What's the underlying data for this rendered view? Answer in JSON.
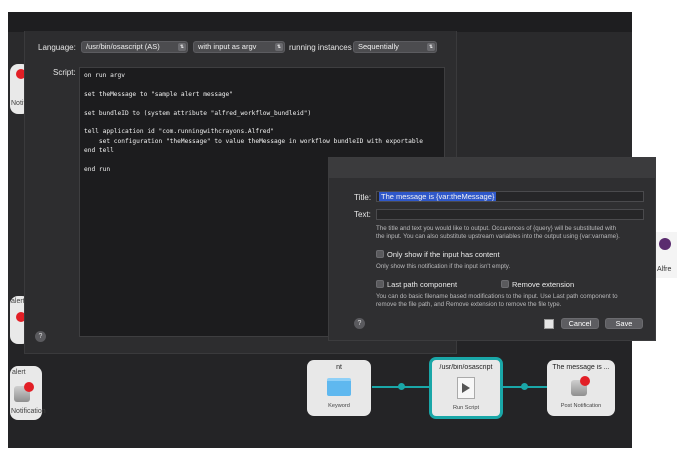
{
  "editor": {
    "language_label": "Language:",
    "language_value": "/usr/bin/osascript (AS)",
    "input_value": "with input as argv",
    "instances_label": "running instances",
    "instances_value": "Sequentially",
    "script_label": "Script:",
    "script_text": "on run argv\n\nset theMessage to \"sample alert message\"\n\nset bundleID to (system attribute \"alfred_workflow_bundleid\")\n\ntell application id \"com.runningwithcrayons.Alfred\"\n    set configuration \"theMessage\" to value theMessage in workflow bundleID with exportable\nend tell\n\nend run"
  },
  "notification": {
    "title_label": "Title:",
    "title_value": "The message is {var:theMessage}",
    "text_label": "Text:",
    "text_value": "",
    "help_line1": "The title and text you would like to output. Occurences of {query} will be substituted with",
    "help_line2": "the input. You can also substitute upstream variables into the output using {var:varname}.",
    "only_show_label": "Only show if the input has content",
    "only_show_help": "Only show this notification if the input isn't empty.",
    "last_path_label": "Last path component",
    "remove_ext_label": "Remove extension",
    "path_help_line1": "You can do basic filename based modifications to the input. Use Last path component to",
    "path_help_line2": "remove the file path, and Remove extension to remove the file type.",
    "cancel_label": "Cancel",
    "save_label": "Save"
  },
  "workflow": {
    "nodes": [
      {
        "title": "nt",
        "subtitle": "Keyword"
      },
      {
        "title": "/usr/bin/osascript",
        "subtitle": "Run Script"
      },
      {
        "title": "The message is ...",
        "subtitle": "Post Notification"
      }
    ],
    "partial_labels": [
      "Notification",
      "alert",
      "alert",
      "Notification",
      "Alfre"
    ]
  },
  "colors": {
    "accent": "#1aa7a8",
    "alert_red": "#e21f26",
    "panel": "#2d2d2f"
  },
  "icons": [
    "help-icon",
    "folder-icon",
    "script-icon",
    "notification-icon",
    "colorwell-icon"
  ]
}
